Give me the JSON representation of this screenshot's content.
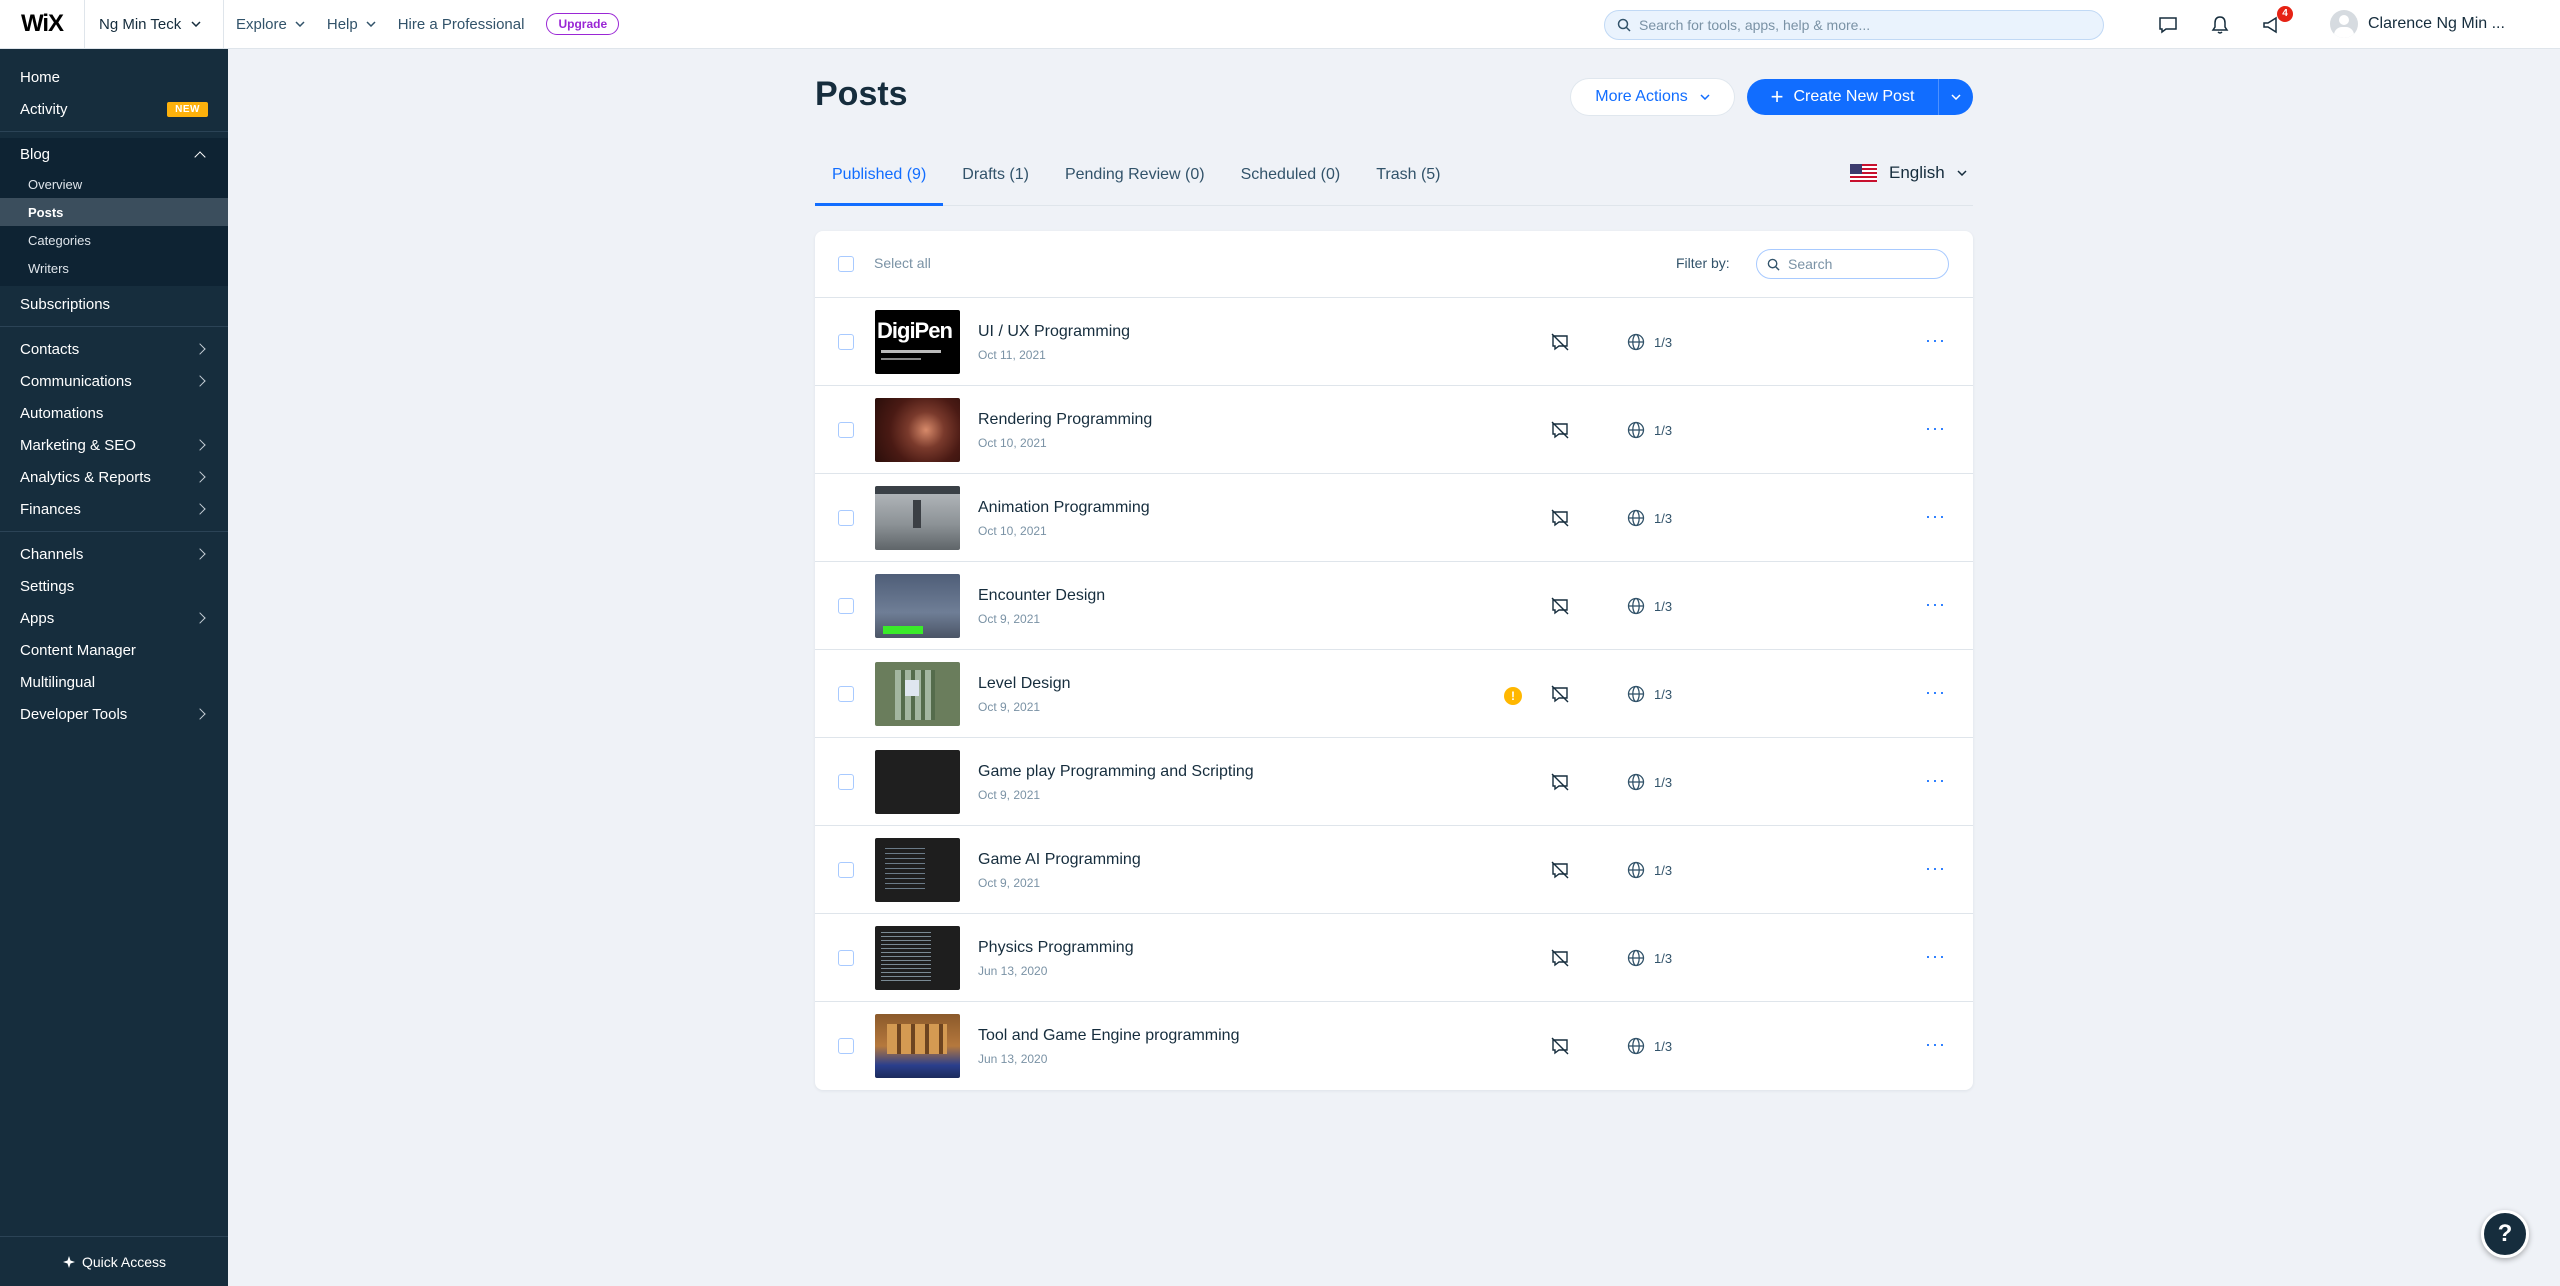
{
  "topbar": {
    "logo": "WiX",
    "site_name": "Ng Min Teck",
    "nav": [
      "Explore",
      "Help",
      "Hire a Professional"
    ],
    "upgrade": "Upgrade",
    "search_placeholder": "Search for tools, apps, help & more...",
    "notifications_count": "4",
    "user_name": "Clarence Ng Min ..."
  },
  "sidebar": {
    "home": "Home",
    "activity": "Activity",
    "activity_badge": "NEW",
    "blog": "Blog",
    "blog_items": [
      "Overview",
      "Posts",
      "Categories",
      "Writers"
    ],
    "subscriptions": "Subscriptions",
    "contacts": "Contacts",
    "communications": "Communications",
    "automations": "Automations",
    "marketing": "Marketing & SEO",
    "analytics": "Analytics & Reports",
    "finances": "Finances",
    "channels": "Channels",
    "settings": "Settings",
    "apps": "Apps",
    "content_manager": "Content Manager",
    "multilingual": "Multilingual",
    "developer_tools": "Developer Tools",
    "quick_access": "Quick Access"
  },
  "main": {
    "title": "Posts",
    "more_actions": "More Actions",
    "create_new_post": "Create New Post",
    "tabs": [
      "Published (9)",
      "Drafts (1)",
      "Pending Review (0)",
      "Scheduled (0)",
      "Trash (5)"
    ],
    "language": "English",
    "select_all": "Select all",
    "filter_by": "Filter by:",
    "filter_search_placeholder": "Search",
    "thumb1_text": "DigiPen",
    "posts": [
      {
        "title": "UI / UX Programming",
        "date": "Oct 11, 2021",
        "languages": "1/3"
      },
      {
        "title": "Rendering Programming",
        "date": "Oct 10, 2021",
        "languages": "1/3"
      },
      {
        "title": "Animation Programming",
        "date": "Oct 10, 2021",
        "languages": "1/3"
      },
      {
        "title": "Encounter Design",
        "date": "Oct 9, 2021",
        "languages": "1/3"
      },
      {
        "title": "Level Design",
        "date": "Oct 9, 2021",
        "languages": "1/3",
        "warning": "!"
      },
      {
        "title": "Game play Programming and Scripting",
        "date": "Oct 9, 2021",
        "languages": "1/3"
      },
      {
        "title": "Game AI Programming",
        "date": "Oct 9, 2021",
        "languages": "1/3"
      },
      {
        "title": "Physics Programming",
        "date": "Jun 13, 2020",
        "languages": "1/3"
      },
      {
        "title": "Tool and Game Engine programming",
        "date": "Jun 13, 2020",
        "languages": "1/3"
      }
    ],
    "row_more": "···"
  },
  "help_button": "?",
  "colors": {
    "accent": "#116dff",
    "sidebar_bg": "#162d3d",
    "page_bg": "#eff2f7",
    "upgrade": "#9a27d5",
    "new_badge": "#fdb10c",
    "warning": "#ffb700"
  }
}
